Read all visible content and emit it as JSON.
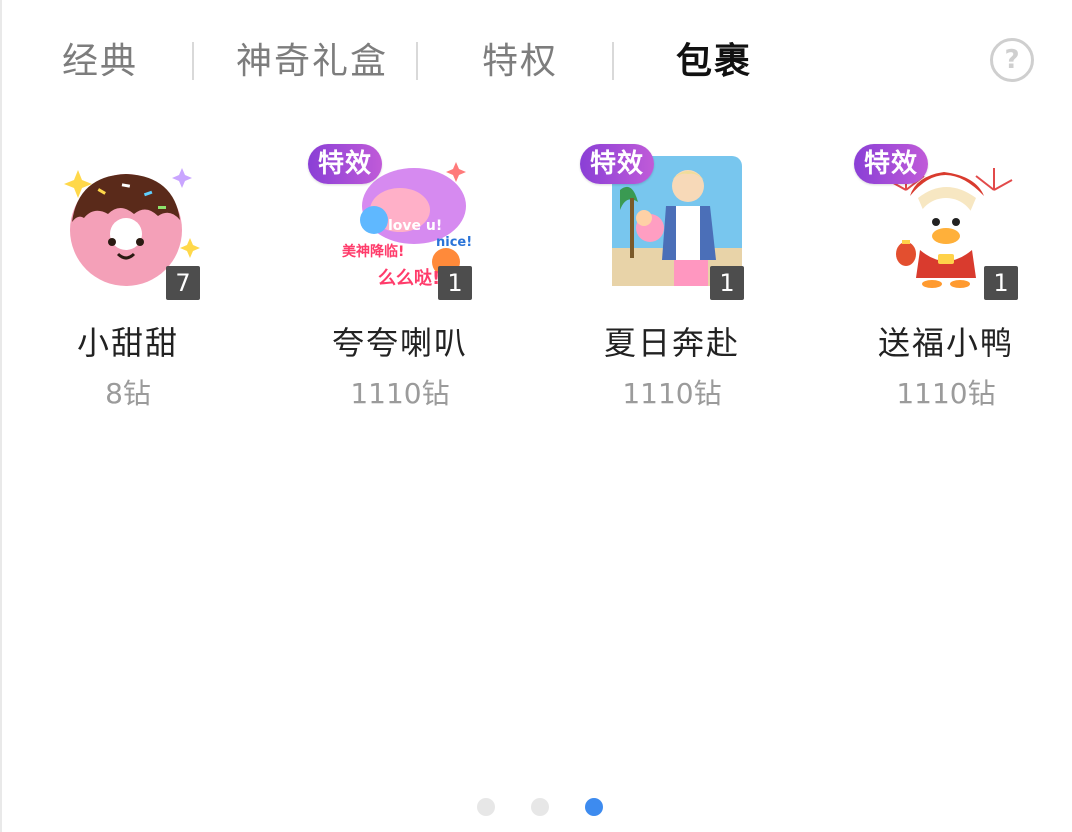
{
  "tabs": [
    {
      "label": "经典",
      "active": false
    },
    {
      "label": "神奇礼盒",
      "active": false
    },
    {
      "label": "特权",
      "active": false
    },
    {
      "label": "包裹",
      "active": true
    }
  ],
  "help_symbol": "?",
  "gifts": [
    {
      "name": "小甜甜",
      "price": "8钻",
      "count": "7",
      "badge": "",
      "icon": "donut-icon"
    },
    {
      "name": "夸夸喇叭",
      "price": "1110钻",
      "count": "1",
      "badge": "特效",
      "icon": "praise-sticker-icon"
    },
    {
      "name": "夏日奔赴",
      "price": "1110钻",
      "count": "1",
      "badge": "特效",
      "icon": "summer-man-icon"
    },
    {
      "name": "送福小鸭",
      "price": "1110钻",
      "count": "1",
      "badge": "特效",
      "icon": "lucky-duck-icon"
    }
  ],
  "gift_image_text": {
    "love": "love u!",
    "nice": "nice!",
    "meishen": "美神降临!",
    "mmd": "么么哒!"
  },
  "pager": {
    "pages": 3,
    "current": 3
  },
  "colors": {
    "accent": "#3d8bef",
    "badge": "#8a3fd6",
    "tab_active": "#111111",
    "tab_inactive": "#7d7d7d"
  }
}
